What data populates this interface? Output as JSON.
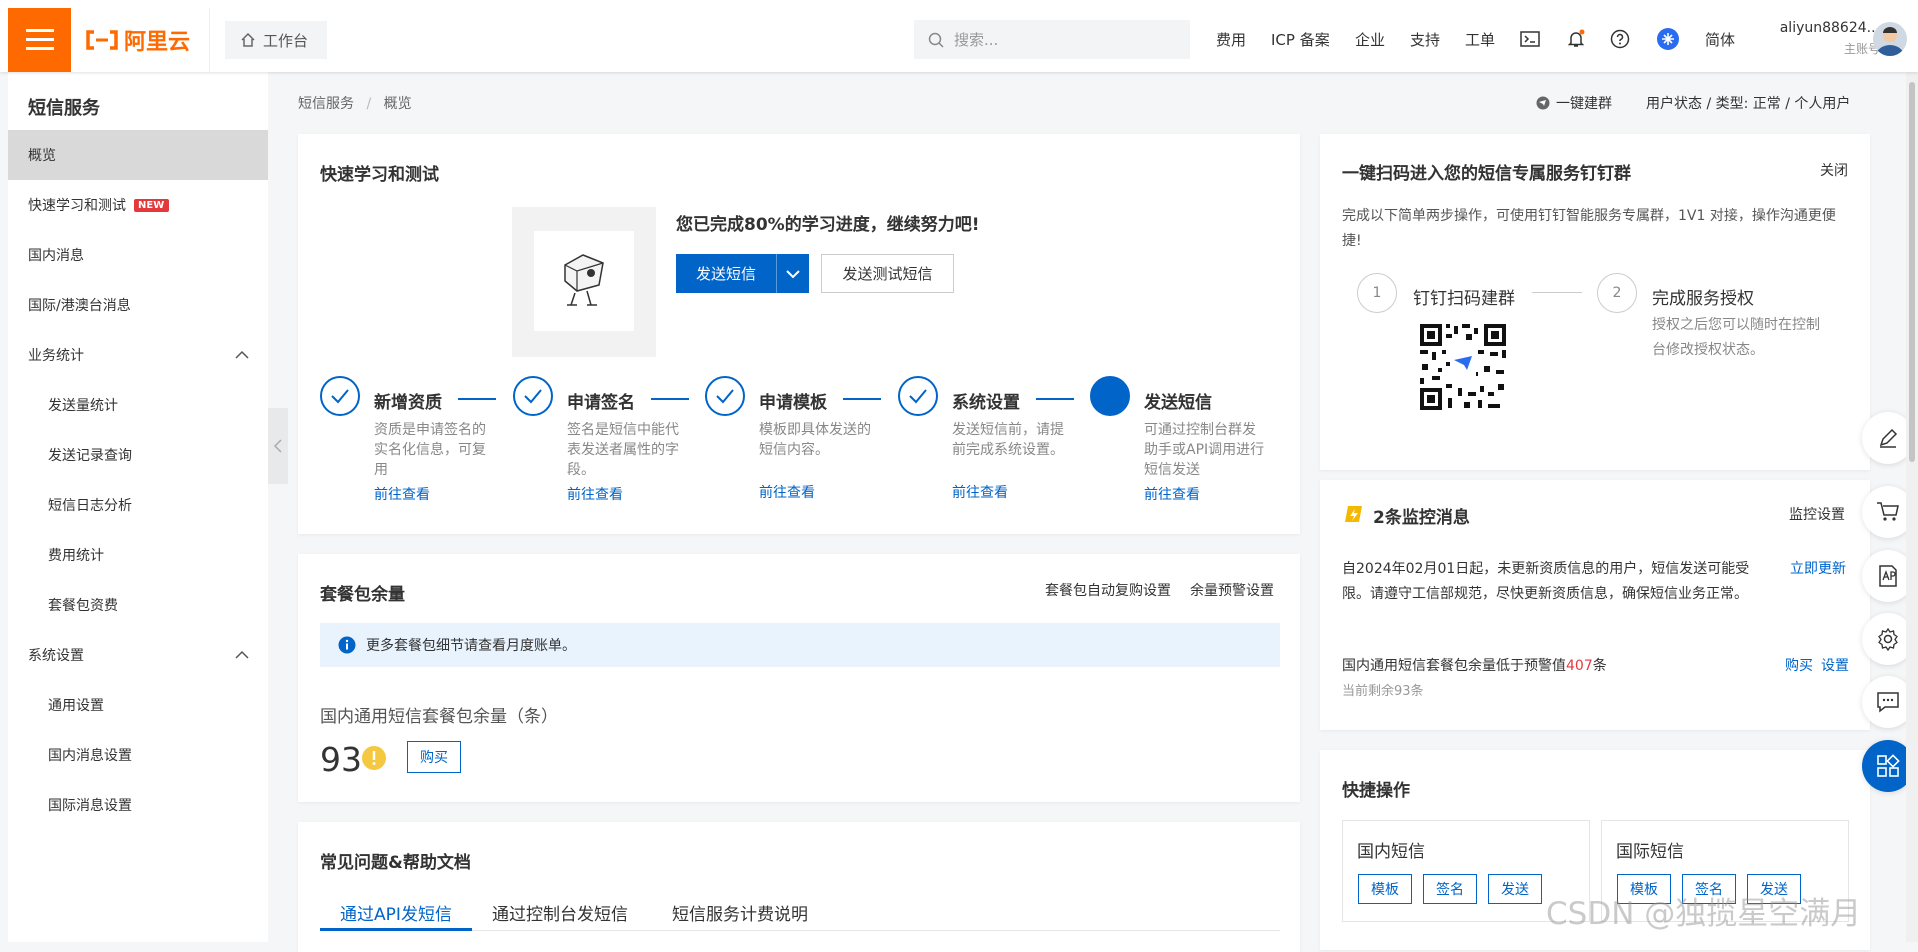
{
  "topbar": {
    "logo_text": "阿里云",
    "workbench": "工作台",
    "search_placeholder": "搜索...",
    "nav": [
      "费用",
      "ICP 备案",
      "企业",
      "支持",
      "工单"
    ],
    "lang": "简体",
    "username": "aliyun88624...",
    "user_role": "主账号"
  },
  "sidebar": {
    "title": "短信服务",
    "items": [
      {
        "label": "概览"
      },
      {
        "label": "快速学习和测试",
        "badge": "NEW"
      },
      {
        "label": "国内消息"
      },
      {
        "label": "国际/港澳台消息"
      },
      {
        "label": "业务统计"
      },
      {
        "label": "发送量统计"
      },
      {
        "label": "发送记录查询"
      },
      {
        "label": "短信日志分析"
      },
      {
        "label": "费用统计"
      },
      {
        "label": "套餐包资费"
      },
      {
        "label": "系统设置"
      },
      {
        "label": "通用设置"
      },
      {
        "label": "国内消息设置"
      },
      {
        "label": "国际消息设置"
      }
    ]
  },
  "breadcrumb": {
    "root": "短信服务",
    "sep": "/",
    "current": "概览"
  },
  "header_right": {
    "group": "一键建群",
    "status": "用户状态 / 类型:  正常 / 个人用户"
  },
  "quick": {
    "title": "快速学习和测试",
    "progress": "您已完成80%的学习进度，继续努力吧!",
    "progress_value": 80,
    "send_button": "发送短信",
    "test_button": "发送测试短信",
    "steps": [
      {
        "title": "新增资质",
        "desc": "资质是申请签名的实名化信息，可复用",
        "link": "前往查看"
      },
      {
        "title": "申请签名",
        "desc": "签名是短信中能代表发送者属性的字段。",
        "link": "前往查看"
      },
      {
        "title": "申请模板",
        "desc": "模板即具体发送的短信内容。",
        "link": "前往查看"
      },
      {
        "title": "系统设置",
        "desc": "发送短信前，请提前完成系统设置。",
        "link": "前往查看"
      },
      {
        "title": "发送短信",
        "desc": "可通过控制台群发助手或API调用进行短信发送",
        "link": "前往查看"
      }
    ]
  },
  "package": {
    "title": "套餐包余量",
    "auto_link": "套餐包自动复购设置",
    "warn_link": "余量预警设置",
    "notice": "更多套餐包细节请查看月度账单。",
    "label": "国内通用短信套餐包余量（条）",
    "count": "93",
    "buy": "购买"
  },
  "faq": {
    "title": "常见问题&帮助文档",
    "tabs": [
      "通过API发短信",
      "通过控制台发短信",
      "短信服务计费说明"
    ]
  },
  "dingtalk": {
    "title": "一键扫码进入您的短信专属服务钉钉群",
    "close": "关闭",
    "desc": "完成以下简单两步操作，可使用钉钉智能服务专属群，1V1 对接，操作沟通更便捷!",
    "step1_num": "1",
    "step1": "钉钉扫码建群",
    "step2_num": "2",
    "step2": "完成服务授权",
    "step2_desc": "授权之后您可以随时在控制台修改授权状态。"
  },
  "monitor": {
    "title": "2条监控消息",
    "settings": "监控设置",
    "msg1": "自2024年02月01日起，未更新资质信息的用户，短信发送可能受限。请遵守工信部规范，尽快更新资质信息，确保短信业务正常。",
    "msg1_action": "立即更新",
    "msg2_pre": "国内通用短信套餐包余量低于预警值",
    "msg2_num": "407",
    "msg2_post": "条",
    "msg2_sub": "当前剩余93条",
    "msg2_buy": "购买",
    "msg2_set": "设置"
  },
  "shortcuts": {
    "title": "快捷操作",
    "groups": [
      {
        "title": "国内短信",
        "buttons": [
          "模板",
          "签名",
          "发送"
        ]
      },
      {
        "title": "国际短信",
        "buttons": [
          "模板",
          "签名",
          "发送"
        ]
      }
    ]
  },
  "watermark": "CSDN @独揽星空满月",
  "colors": {
    "brand": "#ff6a00",
    "primary": "#0064c8",
    "warn": "#e4393c"
  }
}
